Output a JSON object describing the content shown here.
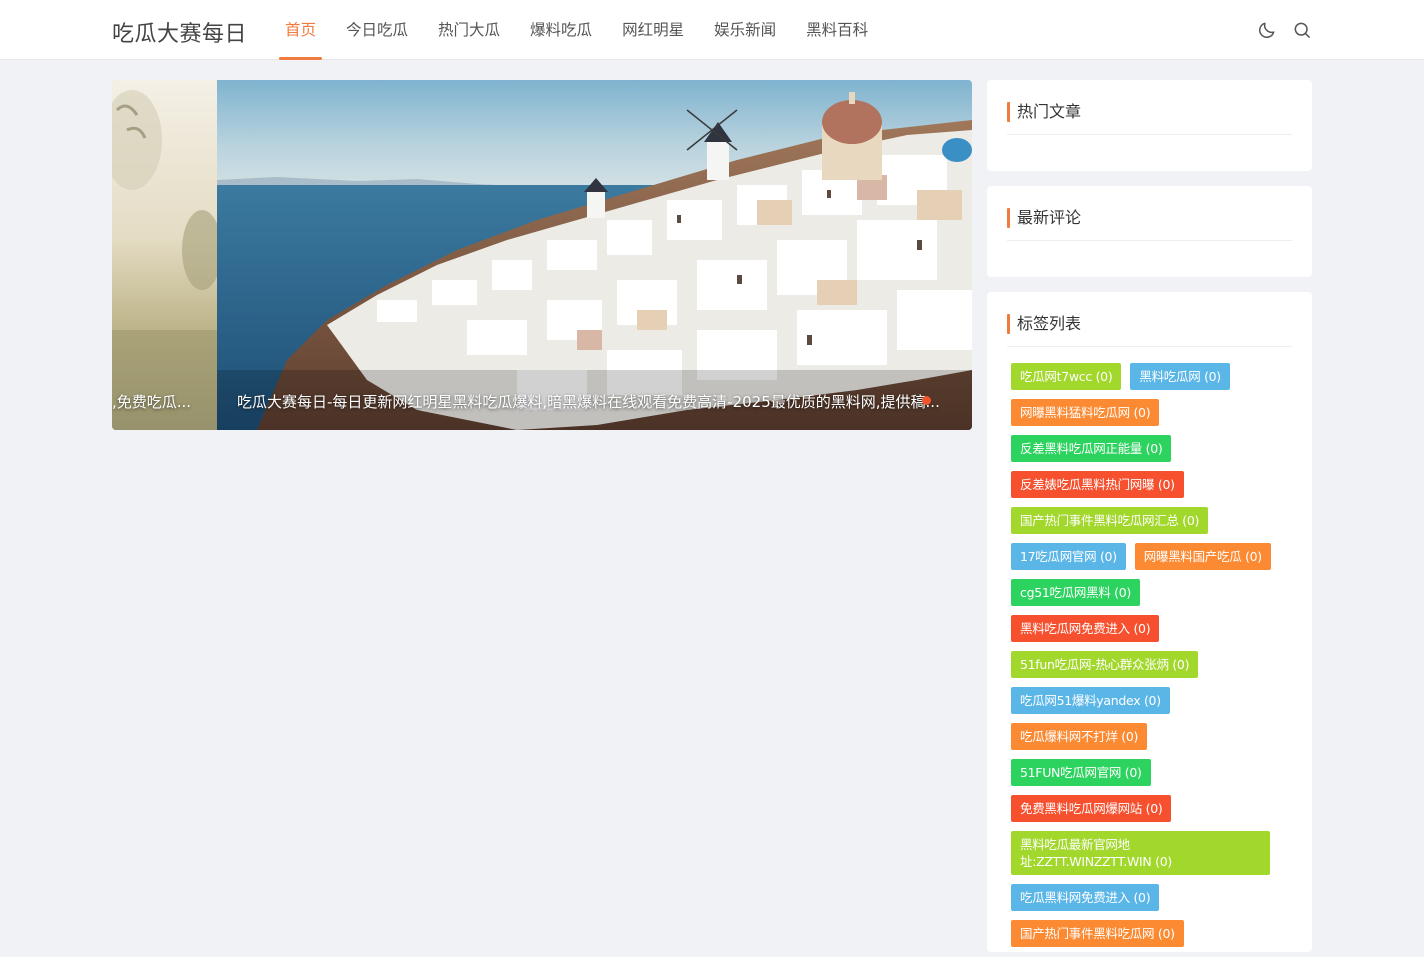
{
  "header": {
    "logo": "吃瓜大赛每日",
    "nav": [
      "首页",
      "今日吃瓜",
      "热门大瓜",
      "爆料吃瓜",
      "网红明星",
      "娱乐新闻",
      "黑料百科"
    ],
    "active_index": 0
  },
  "slider": {
    "prev_caption": ",免费吃瓜...",
    "main_caption": "吃瓜大赛每日-每日更新网红明星黑料吃瓜爆料,暗黑爆料在线观看免费高清-2025最优质的黑料网,提供稿..."
  },
  "sidebar": {
    "hot_articles_title": "热门文章",
    "latest_comments_title": "最新评论",
    "tags_title": "标签列表",
    "tags": [
      {
        "label": "吃瓜网t7wcc (0)",
        "color": "#a2d72c"
      },
      {
        "label": "黑料吃瓜网 (0)",
        "color": "#5bb6e8"
      },
      {
        "label": "网曝黑料猛料吃瓜网 (0)",
        "color": "#fb8a33"
      },
      {
        "label": "反差黑料吃瓜网正能量 (0)",
        "color": "#2dd35f"
      },
      {
        "label": "反差婊吃瓜黑料热门网曝 (0)",
        "color": "#f6502f"
      },
      {
        "label": "国产热门事件黑料吃瓜网汇总 (0)",
        "color": "#a2d72c"
      },
      {
        "label": "17吃瓜网官网 (0)",
        "color": "#5bb6e8"
      },
      {
        "label": "网曝黑料国产吃瓜 (0)",
        "color": "#fb8a33"
      },
      {
        "label": "cg51吃瓜网黑料 (0)",
        "color": "#2dd35f"
      },
      {
        "label": "黑料吃瓜网免费进入 (0)",
        "color": "#f6502f"
      },
      {
        "label": "51fun吃瓜网-热心群众张炳 (0)",
        "color": "#a2d72c"
      },
      {
        "label": "吃瓜网51爆料yandex (0)",
        "color": "#5bb6e8"
      },
      {
        "label": "吃瓜爆料网不打烊 (0)",
        "color": "#fb8a33"
      },
      {
        "label": "51FUN吃瓜网官网 (0)",
        "color": "#2dd35f"
      },
      {
        "label": "免费黑料吃瓜网爆网站 (0)",
        "color": "#f6502f"
      },
      {
        "label": "黑料吃瓜最新官网地址:ZZTT.WINZZTT.WIN (0)",
        "color": "#a2d72c"
      },
      {
        "label": "吃瓜黑料网免费进入 (0)",
        "color": "#5bb6e8"
      },
      {
        "label": "国产热门事件黑料吃瓜网 (0)",
        "color": "#fb8a33"
      }
    ]
  },
  "icons": {
    "theme_toggle": "moon-icon",
    "search": "search-icon"
  }
}
